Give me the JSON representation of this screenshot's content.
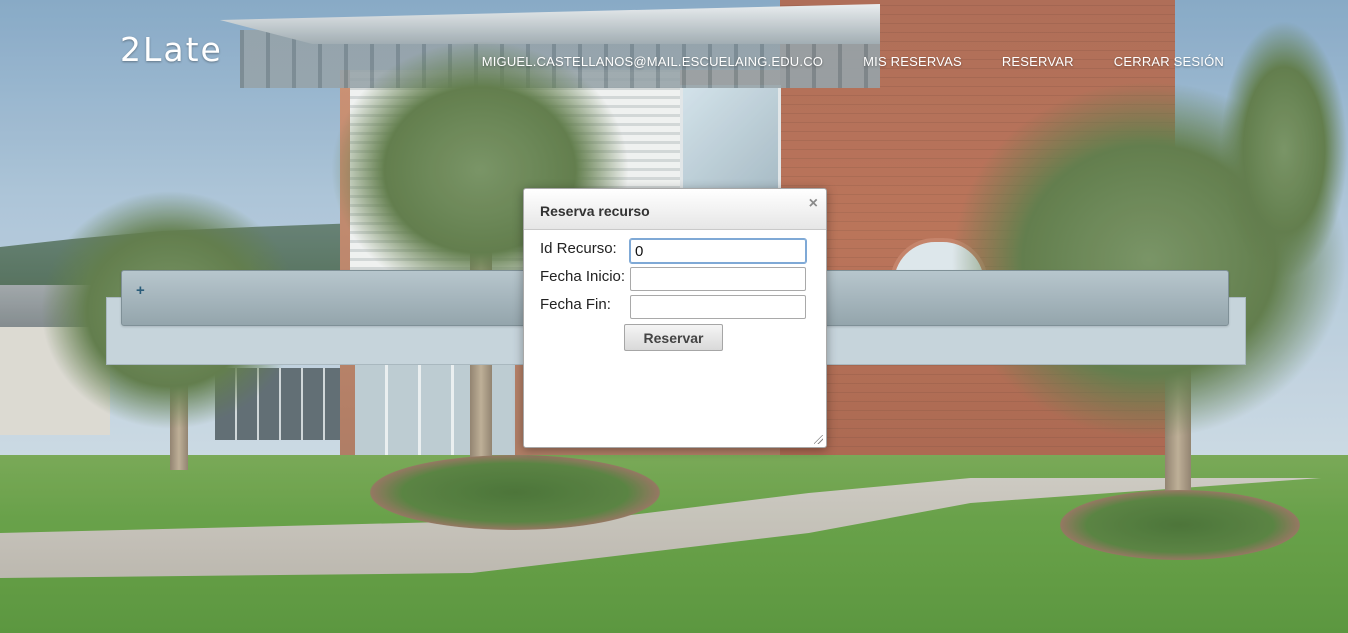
{
  "header": {
    "logo": "2Late",
    "nav": [
      {
        "label": "MIGUEL.CASTELLANOS@MAIL.ESCUELAING.EDU.CO"
      },
      {
        "label": "MIS RESERVAS"
      },
      {
        "label": "RESERVAR"
      },
      {
        "label": "CERRAR SESIÓN"
      }
    ]
  },
  "panel": {
    "expand_icon": "+"
  },
  "dialog": {
    "title": "Reserva recurso",
    "close_icon": "×",
    "fields": [
      {
        "label": "Id Recurso:",
        "value": "0"
      },
      {
        "label": "Fecha Inicio:",
        "value": ""
      },
      {
        "label": "Fecha Fin:",
        "value": ""
      }
    ],
    "submit_label": "Reservar"
  },
  "icons": {
    "close": "close-icon",
    "expand": "plus-icon",
    "resize": "resize-grip-icon"
  }
}
